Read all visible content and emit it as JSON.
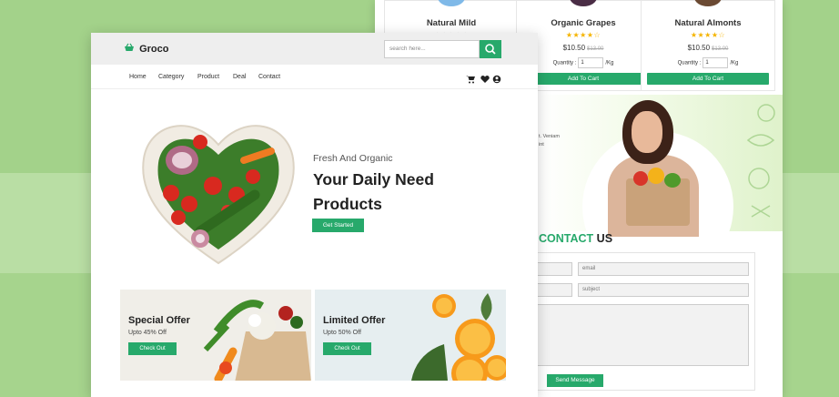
{
  "colors": {
    "brand_green": "#27a96b",
    "bg_green": "#a3d28a",
    "star": "#f5b400"
  },
  "back": {
    "products": [
      {
        "name": "Natural Mild",
        "stars": "★★★★★",
        "price": "",
        "old_price": "",
        "qty_label": "",
        "qty": "",
        "unit": "",
        "cart": ""
      },
      {
        "name": "Organic Grapes",
        "stars": "★★★★☆",
        "price": "$10.50",
        "old_price": "$13.00",
        "qty_label": "Quantity :",
        "qty": "1",
        "unit": "/Kg",
        "cart": "Add To Cart"
      },
      {
        "name": "Natural Almonts",
        "stars": "★★★★☆",
        "price": "$10.50",
        "old_price": "$13.00",
        "qty_label": "Quantity :",
        "qty": "1",
        "unit": "/Kg",
        "cart": "Add To Cart"
      }
    ],
    "promo_text_1": "t. Veniam",
    "promo_text_2": "int",
    "contact": {
      "title_green": "CONTACT",
      "title_rest": " US",
      "email_placeholder": "email",
      "subject_placeholder": "subject",
      "send_label": "Send Message"
    }
  },
  "front": {
    "logo": "Groco",
    "search_placeholder": "search here...",
    "nav": [
      "Home",
      "Category",
      "Product",
      "Deal",
      "Contact"
    ],
    "icons": [
      "cart-icon",
      "heart-icon",
      "user-icon",
      "search-icon",
      "basket-icon"
    ],
    "hero": {
      "subtitle": "Fresh And Organic",
      "title": "Your Daily Need Products",
      "button": "Get Started"
    },
    "offers": [
      {
        "title": "Special Offer",
        "subtitle": "Upto 45% Off",
        "button": "Check Out"
      },
      {
        "title": "Limited Offer",
        "subtitle": "Upto 50% Off",
        "button": "Check Out"
      }
    ]
  }
}
